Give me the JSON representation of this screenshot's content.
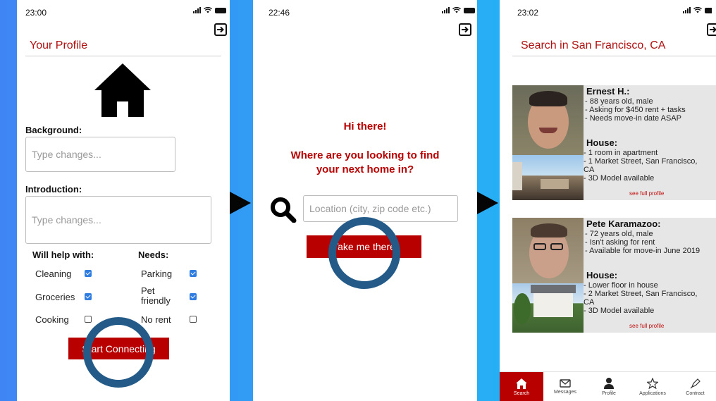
{
  "colors": {
    "accent": "#b80000",
    "ring": "#235a87",
    "background_start": "#3f86f4",
    "background_end": "#1fbdf4"
  },
  "screen1": {
    "time": "23:00",
    "title": "Your Profile",
    "background_label": "Background:",
    "background_placeholder": "Type changes...",
    "introduction_label": "Introduction:",
    "introduction_placeholder": "Type changes...",
    "will_help_title": "Will help with:",
    "needs_title": "Needs:",
    "help_items": [
      {
        "label": "Cleaning",
        "checked": true
      },
      {
        "label": "Groceries",
        "checked": true
      },
      {
        "label": "Cooking",
        "checked": false
      }
    ],
    "needs_items": [
      {
        "label": "Parking",
        "checked": true
      },
      {
        "label": "Pet friendly",
        "checked": true
      },
      {
        "label": "No rent",
        "checked": false
      }
    ],
    "button": "Start Connecting"
  },
  "screen2": {
    "time": "22:46",
    "greeting": "Hi there!",
    "question": "Where are you looking to find your next home in?",
    "location_placeholder": "Location (city, zip code etc.)",
    "button": "Take me there"
  },
  "screen3": {
    "time": "23:02",
    "title": "Search in San Francisco, CA",
    "house_label": "House:",
    "see_full": "see full profile",
    "cards": [
      {
        "name": "Ernest H.:",
        "details": [
          "- 88 years old, male",
          "- Asking for $450 rent + tasks",
          "- Needs move-in date ASAP"
        ],
        "house": [
          "- 1 room in apartment",
          "- 1 Market Street, San Francisco,",
          "CA",
          "- 3D Model available"
        ]
      },
      {
        "name": "Pete Karamazoo:",
        "details": [
          "- 72 years old, male",
          "- Isn't asking for rent",
          "- Available for move-in June 2019"
        ],
        "house": [
          "- Lower floor in house",
          "- 2 Market Street, San Francisco,",
          "CA",
          "- 3D Model available"
        ]
      }
    ],
    "tabs": [
      {
        "label": "Search",
        "icon": "home-icon",
        "active": true
      },
      {
        "label": "Messages",
        "icon": "envelope-icon",
        "active": false
      },
      {
        "label": "Profile",
        "icon": "person-icon",
        "active": false
      },
      {
        "label": "Applications",
        "icon": "star-icon",
        "active": false
      },
      {
        "label": "Contract",
        "icon": "pen-icon",
        "active": false
      }
    ]
  }
}
